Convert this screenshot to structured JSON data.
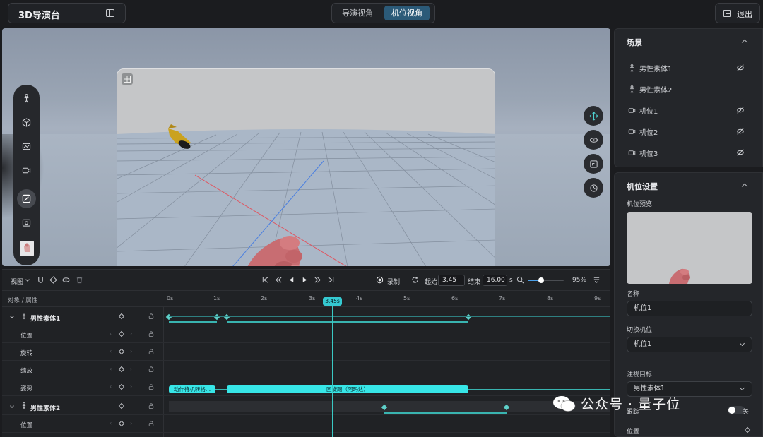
{
  "header": {
    "app_title": "3D导演台",
    "view_tabs": [
      {
        "label": "导演视角",
        "active": false
      },
      {
        "label": "机位视角",
        "active": true
      }
    ],
    "exit_label": "退出"
  },
  "scene_panel": {
    "title": "场景",
    "items": [
      {
        "label": "男性素体1",
        "icon": "person-icon",
        "visibility_icon": "eye-off-icon"
      },
      {
        "label": "男性素体2",
        "icon": "person-icon"
      },
      {
        "label": "机位1",
        "icon": "camera-icon",
        "visibility_icon": "eye-off-icon"
      },
      {
        "label": "机位2",
        "icon": "camera-icon",
        "visibility_icon": "eye-off-icon"
      },
      {
        "label": "机位3",
        "icon": "camera-icon",
        "visibility_icon": "eye-off-icon"
      }
    ]
  },
  "camera_settings": {
    "title": "机位设置",
    "preview_label": "机位预览",
    "name_label": "名称",
    "name_value": "机位1",
    "switch_label": "切换机位",
    "switch_value": "机位1",
    "target_label": "注视目标",
    "target_value": "男性素体1",
    "follow_label": "跟踪",
    "follow_toggle": "关",
    "position_label": "位置"
  },
  "timeline": {
    "view_menu": "视图",
    "record_label": "录制",
    "start_label": "起始",
    "start_value": "3.45",
    "end_label": "结束",
    "end_value": "16.00",
    "end_unit": "s",
    "zoom_percent": "95%",
    "zoom_level": 0.35,
    "header_label": "对象 / 属性",
    "ruler_ticks": [
      "0s",
      "1s",
      "2s",
      "3s",
      "4s",
      "5s",
      "6s",
      "7s",
      "8s",
      "9s"
    ],
    "playhead": "3.45s",
    "rows": [
      {
        "label": "男性素体1",
        "main": true
      },
      {
        "label": "位置"
      },
      {
        "label": "旋转"
      },
      {
        "label": "缩放"
      },
      {
        "label": "姿势"
      },
      {
        "label": "男性素体2",
        "main": true
      },
      {
        "label": "位置"
      }
    ],
    "clips": [
      {
        "label": "动作待机转格..."
      },
      {
        "label": "回旋踢（阿玛达）"
      }
    ]
  },
  "watermark": "公众号 · 量子位",
  "colors": {
    "accent": "#2b5a78",
    "timeline_cyan": "#37e6e7",
    "keyframe": "#5ed0c9"
  }
}
